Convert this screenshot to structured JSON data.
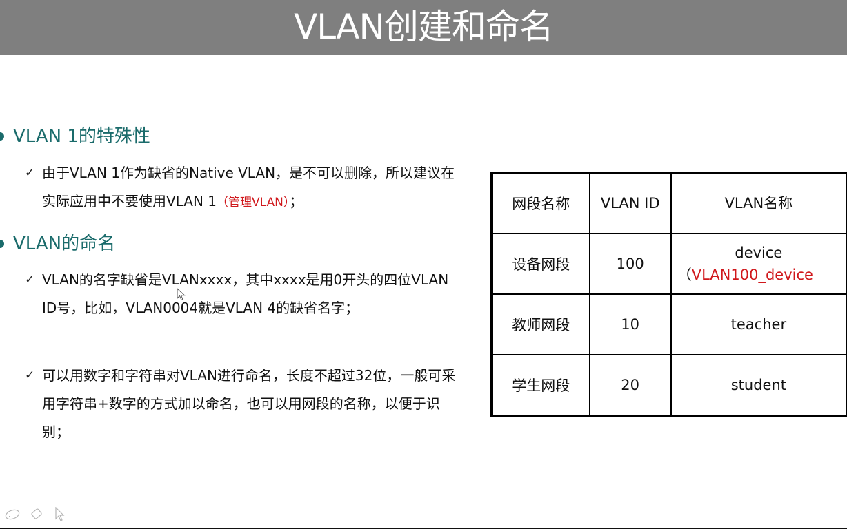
{
  "slide": {
    "title": "VLAN创建和命名"
  },
  "sections": [
    {
      "heading": "VLAN 1的特殊性",
      "bullets": [
        {
          "text": "由于VLAN 1作为缺省的Native VLAN，是不可以删除，所以建议在实际应用中不要使用VLAN 1",
          "highlight": "（管理VLAN）",
          "tail": "；"
        }
      ]
    },
    {
      "heading": "VLAN的命名",
      "bullets": [
        {
          "text": "VLAN的名字缺省是VLANxxxx，其中xxxx是用0开头的四位VLAN ID号，比如，VLAN0004就是VLAN 4的缺省名字；"
        },
        {
          "text": "可以用数字和字符串对VLAN进行命名，长度不超过32位，一般可采用字符串+数字的方式加以命名，也可以用网段的名称，以便于识别；"
        }
      ]
    }
  ],
  "bullet_marker": "✓",
  "table": {
    "headers": [
      "网段名称",
      "VLAN ID",
      "VLAN名称"
    ],
    "rows": [
      {
        "segment": "设备网段",
        "vlan_id": "100",
        "name": "device",
        "name_note_prefix": "（",
        "name_note": "VLAN100_device"
      },
      {
        "segment": "教师网段",
        "vlan_id": "10",
        "name": "teacher"
      },
      {
        "segment": "学生网段",
        "vlan_id": "20",
        "name": "student"
      }
    ]
  },
  "colors": {
    "title_bar": "#7f7f7f",
    "heading": "#1a6b6b",
    "highlight": "#d0181c"
  },
  "toolbar": {
    "icons": [
      "pen-icon",
      "eraser-icon",
      "pointer-icon"
    ]
  }
}
